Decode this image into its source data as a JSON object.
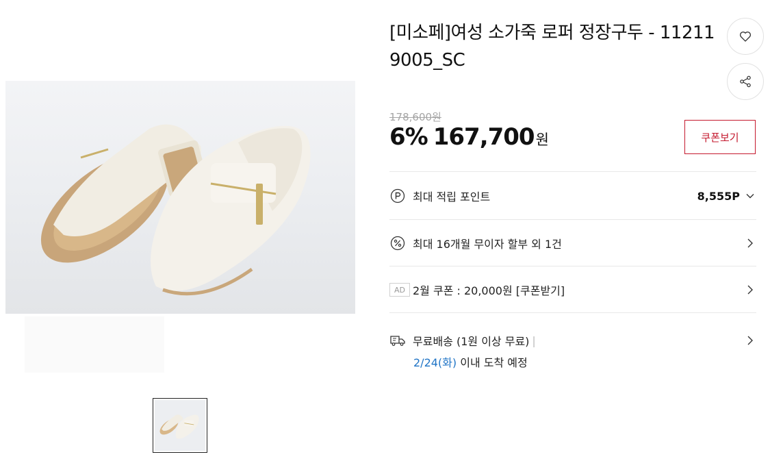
{
  "product": {
    "title": "[미소페]여성 소가죽 로퍼 정장구두 - 112119005_SC"
  },
  "actions": {
    "like_icon": "heart-icon",
    "share_icon": "share-icon"
  },
  "price": {
    "original": "178,600원",
    "discount_rate": "6%",
    "amount": "167,700",
    "unit": "원"
  },
  "coupon": {
    "button_label": "쿠폰보기",
    "accent_color": "#c4182d"
  },
  "benefits": {
    "points": {
      "icon": "point-p-icon",
      "label": "최대 적립 포인트",
      "value": "8,555P"
    },
    "installment": {
      "icon": "percent-icon",
      "label": "최대 16개월 무이자 할부 외 1건"
    },
    "ad_coupon": {
      "badge": "AD",
      "label": "2월 쿠폰 : 20,000원 [쿠폰받기]"
    },
    "delivery": {
      "icon": "truck-icon",
      "label": "무료배송 (1원 이상 무료)",
      "separator": "|",
      "date": "2/24(화)",
      "arrival_text": " 이내 도착 예정",
      "date_color": "#1f74c6"
    }
  }
}
